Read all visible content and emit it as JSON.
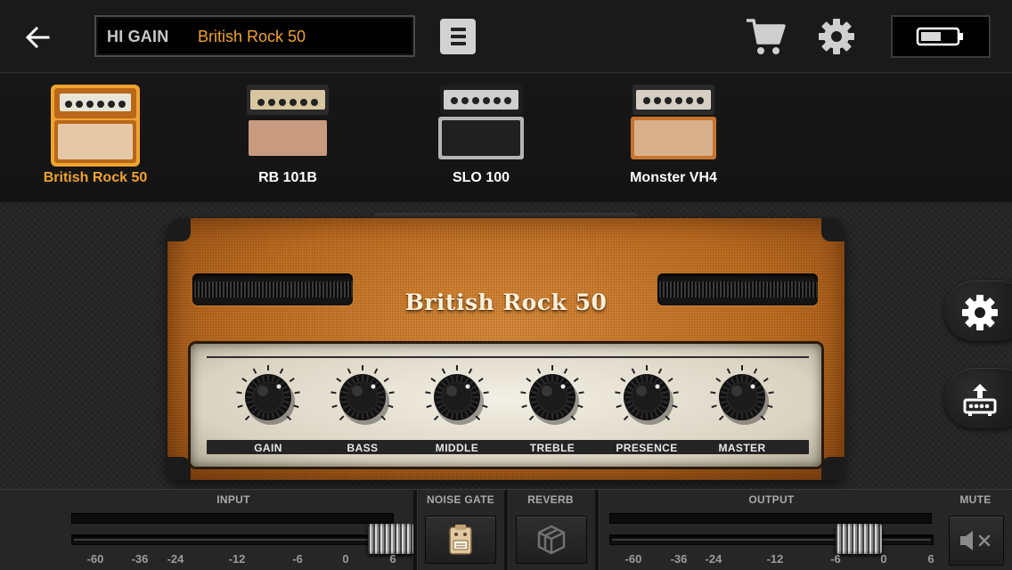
{
  "header": {
    "category": "HI GAIN",
    "preset_name": "British Rock 50"
  },
  "amps": [
    {
      "label": "British Rock 50",
      "selected": true
    },
    {
      "label": "RB 101B",
      "selected": false
    },
    {
      "label": "SLO 100",
      "selected": false
    },
    {
      "label": "Monster VH4",
      "selected": false
    }
  ],
  "amp_head": {
    "logo": "British Rock 50",
    "knobs": [
      {
        "label": "GAIN"
      },
      {
        "label": "BASS"
      },
      {
        "label": "MIDDLE"
      },
      {
        "label": "TREBLE"
      },
      {
        "label": "PRESENCE"
      },
      {
        "label": "MASTER"
      }
    ]
  },
  "bottom": {
    "input_label": "INPUT",
    "noise_gate_label": "NOISE GATE",
    "reverb_label": "REVERB",
    "output_label": "OUTPUT",
    "mute_label": "MUTE",
    "input_scale": [
      "-60",
      "-36",
      "-24",
      "-12",
      "-6",
      "0",
      "6"
    ],
    "output_scale": [
      "-60",
      "-36",
      "-24",
      "-12",
      "-6",
      "0",
      "6"
    ]
  },
  "colors": {
    "accent": "#f0a330",
    "amp_tolex": "#c06e22"
  },
  "icons": {
    "back": "arrow-left-icon",
    "menu": "hamburger-menu-icon",
    "cart": "cart-icon",
    "settings": "gear-icon",
    "battery": "battery-icon",
    "amp_settings": "gear-icon",
    "upload": "upload-icon",
    "noise_gate": "stompbox-icon",
    "reverb": "cube-icon",
    "mute": "speaker-mute-icon"
  }
}
